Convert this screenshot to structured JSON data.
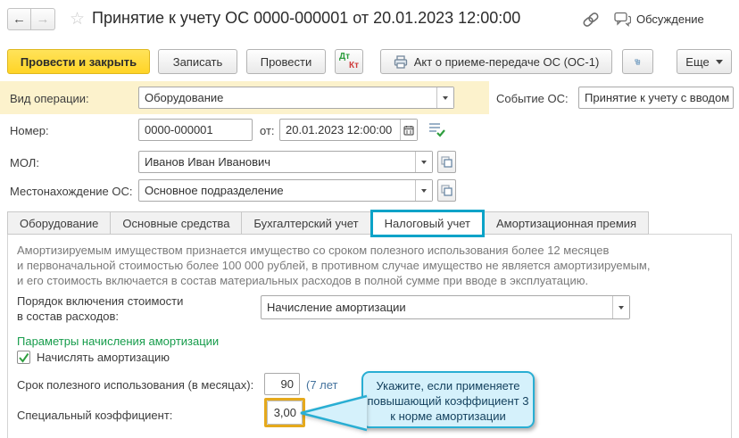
{
  "header": {
    "title": "Принятие к учету ОС 0000-000001 от 20.01.2023 12:00:00",
    "back_icon": "←",
    "forward_icon": "→",
    "favorite_icon": "☆",
    "discussion_label": "Обсуждение"
  },
  "toolbar": {
    "post_and_close_label": "Провести и закрыть",
    "save_label": "Записать",
    "post_label": "Провести",
    "dt_label": "Дт",
    "kt_label": "Кт",
    "act_label": "Акт о приеме-передаче ОС (ОС-1)",
    "more_label": "Еще"
  },
  "form": {
    "operation_kind": {
      "label": "Вид операции:",
      "value": "Оборудование"
    },
    "os_event": {
      "label": "Событие ОС:",
      "value": "Принятие к учету с вводом"
    },
    "number": {
      "label": "Номер:",
      "value": "0000-000001"
    },
    "date": {
      "label": "от:",
      "value": "20.01.2023 12:00:00"
    },
    "mol": {
      "label": "МОЛ:",
      "value": "Иванов Иван Иванович"
    },
    "location": {
      "label": "Местонахождение ОС:",
      "value": "Основное подразделение"
    }
  },
  "tabs": [
    {
      "label": "Оборудование",
      "active": false
    },
    {
      "label": "Основные средства",
      "active": false
    },
    {
      "label": "Бухгалтерский учет",
      "active": false
    },
    {
      "label": "Налоговый учет",
      "active": true
    },
    {
      "label": "Амортизационная премия",
      "active": false
    }
  ],
  "tax_tab": {
    "info_lines": [
      "Амортизируемым имуществом признается имущество со сроком полезного использования более 12 месяцев",
      "и первоначальной стоимостью более 100 000 рублей, в противном случае имущество не является амортизируемым,",
      "и его стоимость включается в состав материальных расходов в полной сумме при вводе в эксплуатацию."
    ],
    "include_order": {
      "label_line1": "Порядок включения стоимости",
      "label_line2": "в состав расходов:",
      "value": "Начисление амортизации"
    },
    "section_header": "Параметры начисления амортизации",
    "accrue_checkbox": {
      "checked": true,
      "label": "Начислять амортизацию"
    },
    "useful_life": {
      "label": "Срок полезного использования (в месяцах):",
      "value": "90",
      "hint": "(7 лет"
    },
    "special_coefficient": {
      "label": "Специальный коэффициент:",
      "value": "3,00"
    }
  },
  "callout": {
    "lines": [
      "Укажите, если применяете",
      "повышающий коэффициент 3",
      "к норме амортизации"
    ]
  },
  "colors": {
    "primary_button_yellow": "#ffd426",
    "operation_band_yellow": "#fcf2cc",
    "tab_annotation_teal": "#0ba3c8",
    "field_highlight_orange": "#e5a91c",
    "section_header_green": "#169c4b",
    "checkbox_check_green": "#2f9e3f",
    "hint_blue": "#44739e",
    "callout_bg": "#d5f1fb",
    "callout_border": "#29aed3",
    "callout_text": "#123f5c",
    "info_text_gray": "#7a7a7a"
  }
}
